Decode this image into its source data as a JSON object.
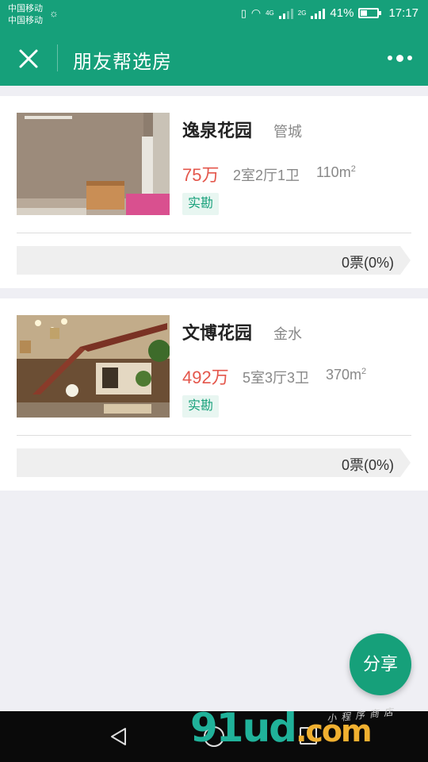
{
  "status_bar": {
    "carrier_1": "中国移动",
    "carrier_2": "中国移动",
    "net_1": "4G",
    "net_2": "2G",
    "battery_percent": "41%",
    "battery_level": 0.41,
    "time": "17:17"
  },
  "nav": {
    "title": "朋友帮选房",
    "close_icon": "close-icon",
    "more_icon": "more-dots-icon"
  },
  "listings": [
    {
      "name": "逸泉花园",
      "district": "管城",
      "price": "75万",
      "layout": "2室2厅1卫",
      "area": "110m",
      "area_unit_sup": "2",
      "badge": "实勘",
      "votes": "0票(0%)"
    },
    {
      "name": "文博花园",
      "district": "金水",
      "price": "492万",
      "layout": "5室3厅3卫",
      "area": "370m",
      "area_unit_sup": "2",
      "badge": "实勘",
      "votes": "0票(0%)"
    }
  ],
  "share_button": "分享",
  "watermark": {
    "main": "91ud",
    "suffix": ".com",
    "sub": "小程序商店"
  },
  "colors": {
    "brand": "#16a07a",
    "price": "#e4574c",
    "background": "#efeff4"
  }
}
